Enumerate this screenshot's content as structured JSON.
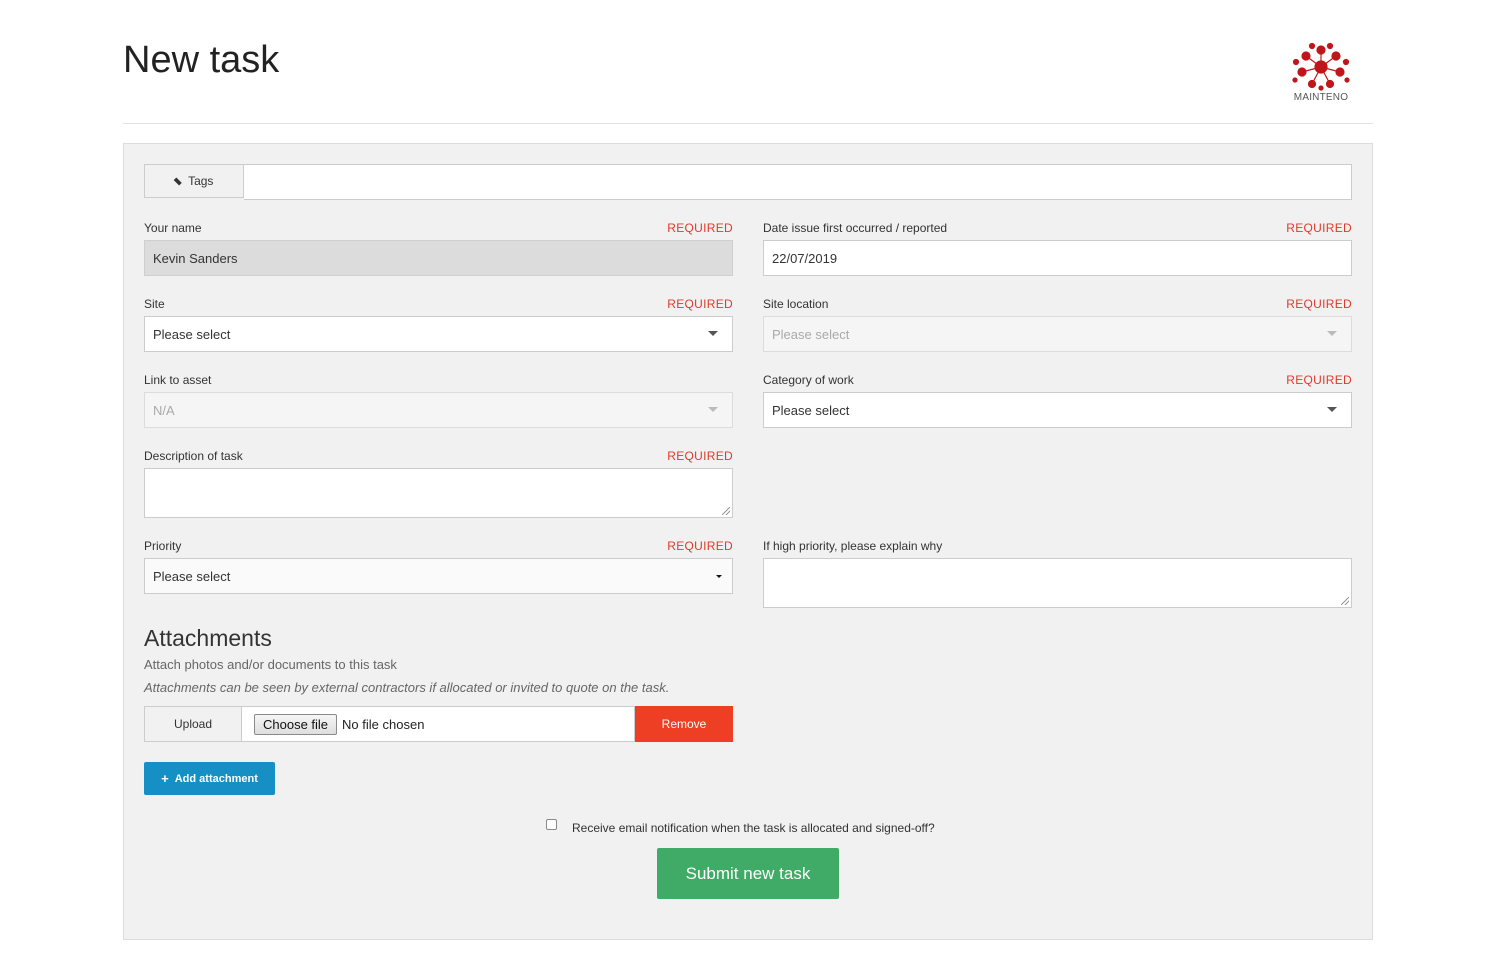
{
  "header": {
    "title": "New task",
    "logo_text": "MAINTENO"
  },
  "tags": {
    "label": "Tags",
    "value": ""
  },
  "required_label": "REQUIRED",
  "fields": {
    "your_name": {
      "label": "Your name",
      "value": "Kevin Sanders",
      "required": true
    },
    "date": {
      "label": "Date issue first occurred / reported",
      "value": "22/07/2019",
      "required": true
    },
    "site": {
      "label": "Site",
      "value": "Please select",
      "required": true
    },
    "site_location": {
      "label": "Site location",
      "value": "Please select",
      "required": true,
      "disabled": true
    },
    "link_to_asset": {
      "label": "Link to asset",
      "value": "N/A",
      "disabled": true
    },
    "category": {
      "label": "Category of work",
      "value": "Please select",
      "required": true
    },
    "description": {
      "label": "Description of task",
      "value": "",
      "required": true
    },
    "priority": {
      "label": "Priority",
      "value": "Please select",
      "required": true
    },
    "high_priority_reason": {
      "label": "If high priority, please explain why",
      "value": ""
    }
  },
  "attachments": {
    "title": "Attachments",
    "subtitle": "Attach photos and/or documents to this task",
    "note": "Attachments can be seen by external contractors if allocated or invited to quote on the task.",
    "upload_label": "Upload",
    "choose_file_label": "Choose file",
    "no_file_text": "No file chosen",
    "remove_label": "Remove",
    "add_label": "Add attachment"
  },
  "notification": {
    "label": "Receive email notification when the task is allocated and signed-off?",
    "checked": false
  },
  "submit_label": "Submit new task",
  "colors": {
    "required": "#e03a2a",
    "remove": "#ee3f24",
    "add": "#168fc4",
    "submit": "#3fab66",
    "logo": "#c0161b"
  },
  "icons": {
    "tag": "tag-icon",
    "plus": "plus-icon",
    "caret": "caret-down-icon"
  }
}
